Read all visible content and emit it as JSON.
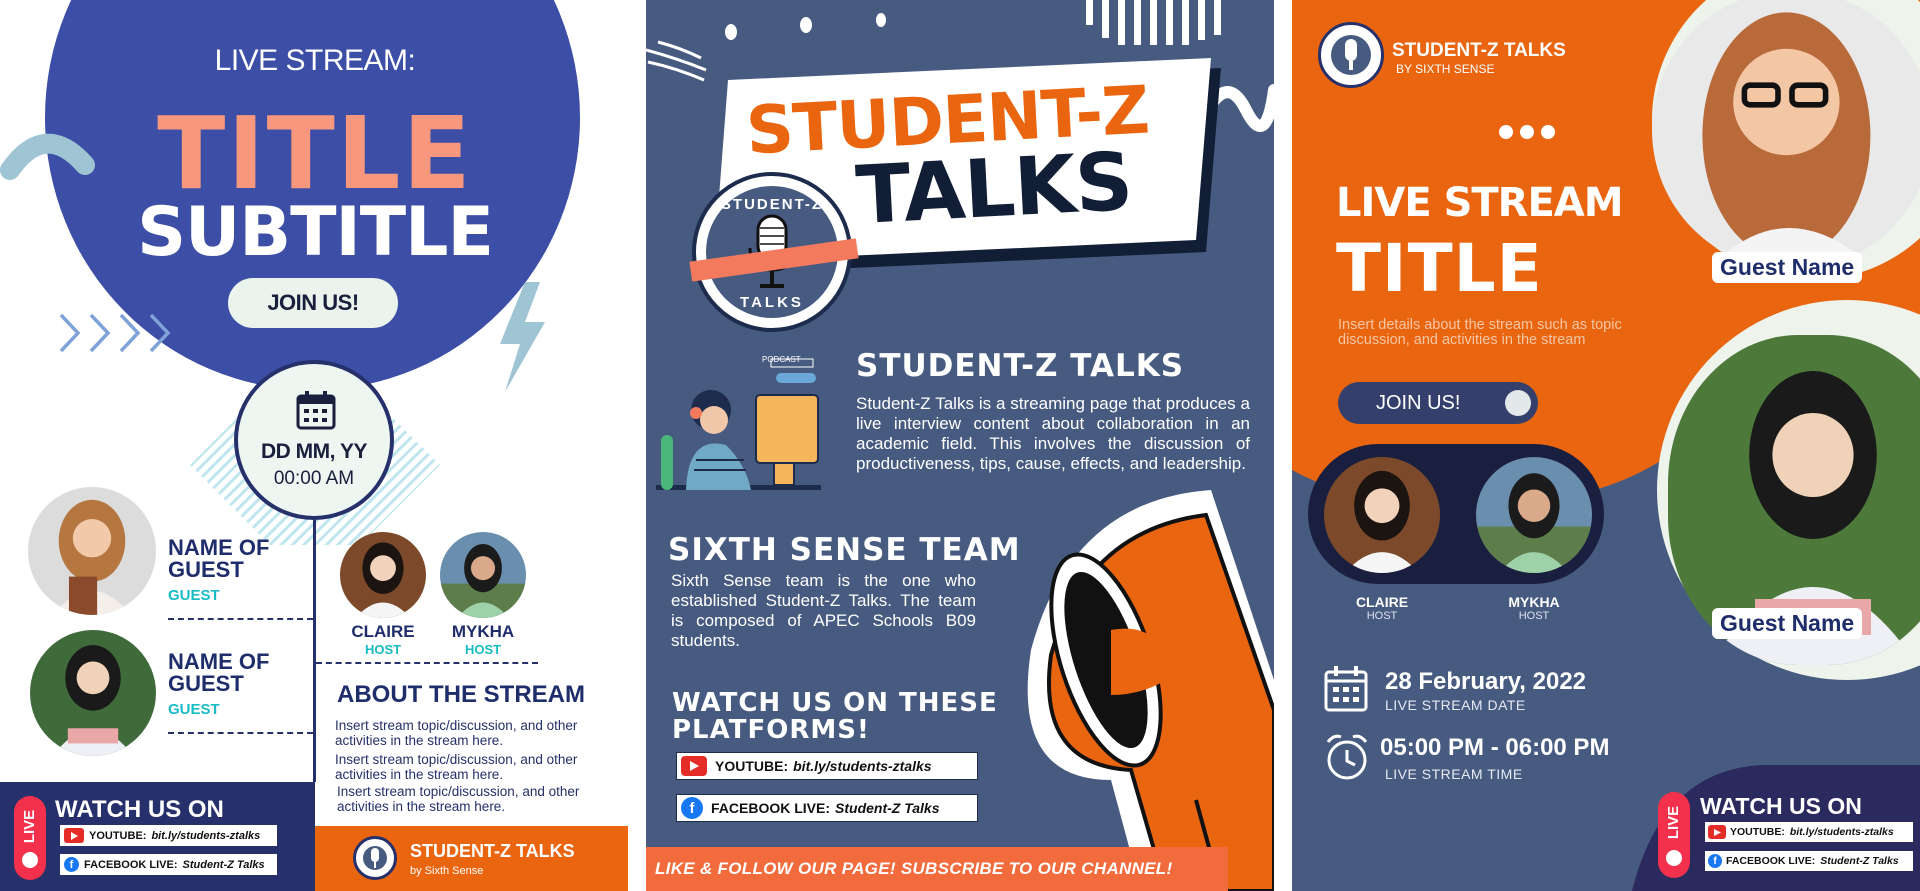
{
  "left_poster": {
    "eyebrow": "LIVE STREAM:",
    "title": "TITLE",
    "subtitle": "SUBTITLE",
    "join_label": "JOIN US!",
    "date": "DD MM, YY",
    "time": "00:00 AM",
    "guests": [
      {
        "name_line1": "NAME OF",
        "name_line2": "GUEST",
        "role": "GUEST"
      },
      {
        "name_line1": "NAME OF",
        "name_line2": "GUEST",
        "role": "GUEST"
      }
    ],
    "hosts": [
      {
        "name": "CLAIRE",
        "role": "HOST"
      },
      {
        "name": "MYKHA",
        "role": "HOST"
      }
    ],
    "about_heading": "ABOUT THE STREAM",
    "about_paragraphs": [
      "Insert stream topic/discussion, and other activities in the stream here.",
      "Insert stream topic/discussion, and other activities in the stream here.",
      "Insert stream topic/discussion, and other activities in the stream here."
    ],
    "live_badge": "LIVE",
    "watch_heading": "WATCH US ON",
    "platforms": [
      {
        "label": "YOUTUBE:",
        "value": "bit.ly/students-ztalks"
      },
      {
        "label": "FACEBOOK LIVE:",
        "value": "Student-Z Talks"
      }
    ],
    "brand_name": "STUDENT-Z TALKS",
    "brand_by": "by Sixth Sense"
  },
  "middle_poster": {
    "banner_line1": "STUDENT-Z",
    "banner_line2": "TALKS",
    "logo_top": "STUDENT-Z",
    "logo_bottom": "TALKS",
    "podcast_tag": "PODCAST",
    "about_heading": "STUDENT-Z TALKS",
    "about_text": "Student-Z Talks is a streaming page that produces a live interview content about collaboration in an academic field. This involves the discussion of productiveness, tips, cause, effects, and leadership.",
    "team_heading": "SIXTH SENSE TEAM",
    "team_text": "Sixth Sense team is the one who established Student-Z Talks. The team is composed of APEC Schools B09 students.",
    "watch_heading_line1": "WATCH US ON THESE",
    "watch_heading_line2": "PLATFORMS!",
    "platforms": [
      {
        "label": "YOUTUBE:",
        "value": "bit.ly/students-ztalks"
      },
      {
        "label": "FACEBOOK LIVE:",
        "value": "Student-Z Talks"
      }
    ],
    "footer": "LIKE & FOLLOW OUR PAGE!  SUBSCRIBE TO OUR CHANNEL!"
  },
  "right_poster": {
    "brand_name": "STUDENT-Z TALKS",
    "brand_by": "BY SIXTH SENSE",
    "live_stream": "LIVE STREAM",
    "title": "TITLE",
    "description": "Insert details about the stream such as topic discussion, and activities in the stream",
    "join_label": "JOIN US!",
    "guest_tags": [
      "Guest Name",
      "Guest Name"
    ],
    "hosts": [
      {
        "name": "CLAIRE",
        "role": "HOST"
      },
      {
        "name": "MYKHA",
        "role": "HOST"
      }
    ],
    "date": "28 February, 2022",
    "date_caption": "LIVE STREAM DATE",
    "time": "05:00 PM - 06:00 PM",
    "time_caption": "LIVE STREAM TIME",
    "live_badge": "LIVE",
    "watch_heading": "WATCH US ON",
    "platforms": [
      {
        "label": "YOUTUBE:",
        "value": "bit.ly/students-ztalks"
      },
      {
        "label": "FACEBOOK LIVE:",
        "value": "Student-Z Talks"
      }
    ]
  },
  "colors": {
    "navy": "#26306a",
    "royal_blue": "#3d4ea7",
    "slate_blue": "#475b80",
    "orange": "#e9650f",
    "salmon": "#f7977e",
    "teal": "#19bcc4",
    "mint": "#eaf4ec",
    "youtube_red": "#e52d27",
    "facebook_blue": "#1877f2"
  }
}
